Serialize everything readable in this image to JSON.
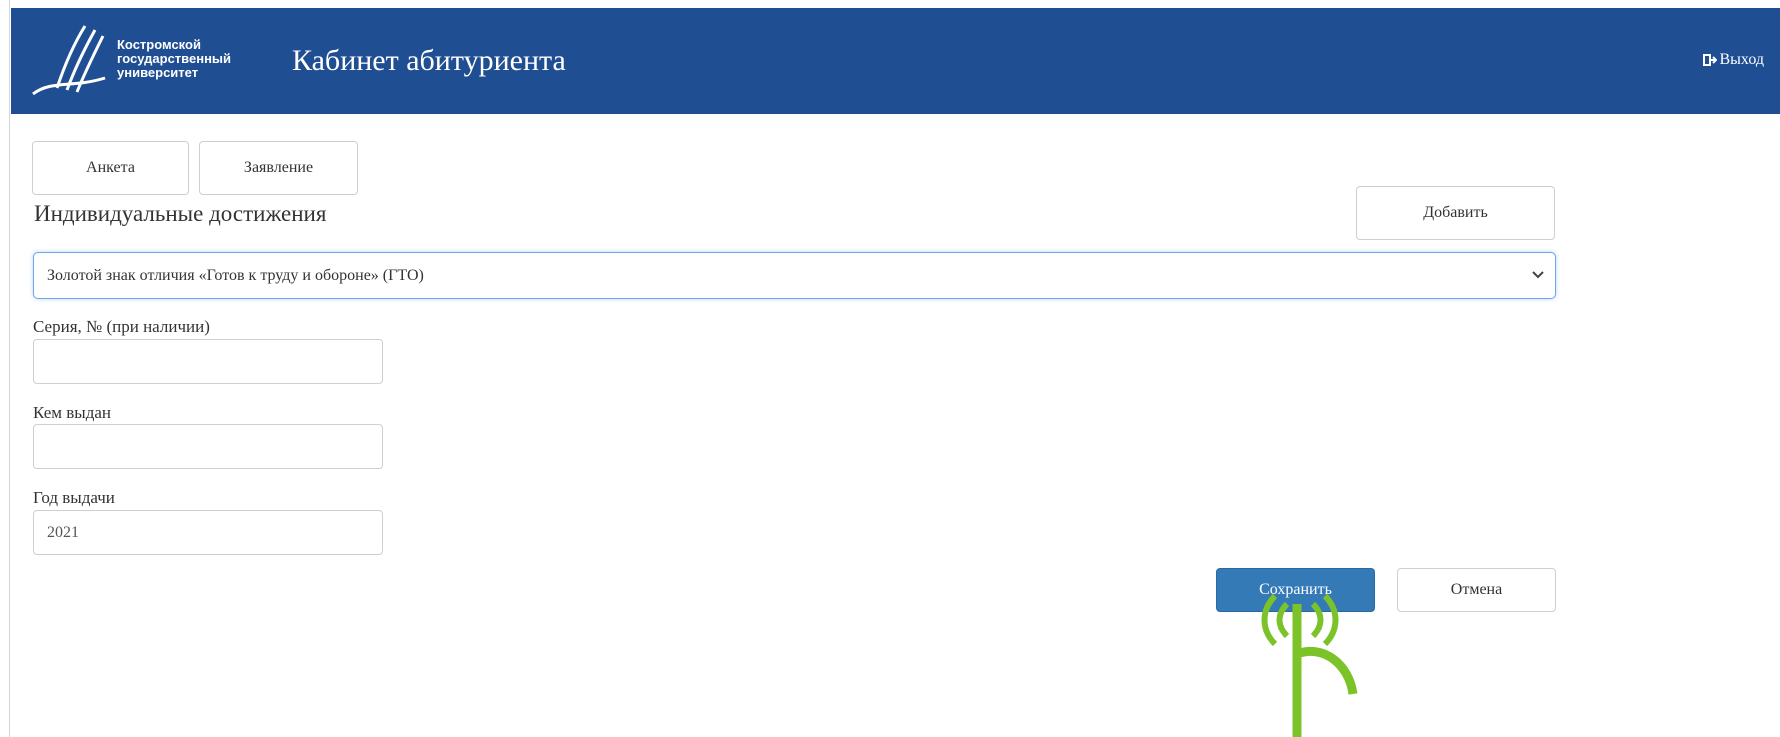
{
  "header": {
    "logo_lines": [
      "Костромской",
      "государственный",
      "университет"
    ],
    "title": "Кабинет абитуриента",
    "logout_label": "Выход",
    "logout_icon": "sign-out-icon",
    "background_color": "#1f4e93"
  },
  "tabs": [
    {
      "label": "Анкета"
    },
    {
      "label": "Заявление"
    }
  ],
  "section": {
    "title": "Индивидуальные достижения",
    "add_label": "Добавить"
  },
  "achievement_select": {
    "selected": "Золотой знак отличия «Готов к труду и обороне» (ГТО)",
    "icon": "chevron-down-icon"
  },
  "form": {
    "series_label": "Серия, № (при наличии)",
    "series_value": "",
    "issuer_label": "Кем выдан",
    "issuer_value": "",
    "year_label": "Год выдачи",
    "year_value": "2021"
  },
  "actions": {
    "save_label": "Сохранить",
    "cancel_label": "Отмена",
    "primary_color": "#337ab7"
  }
}
